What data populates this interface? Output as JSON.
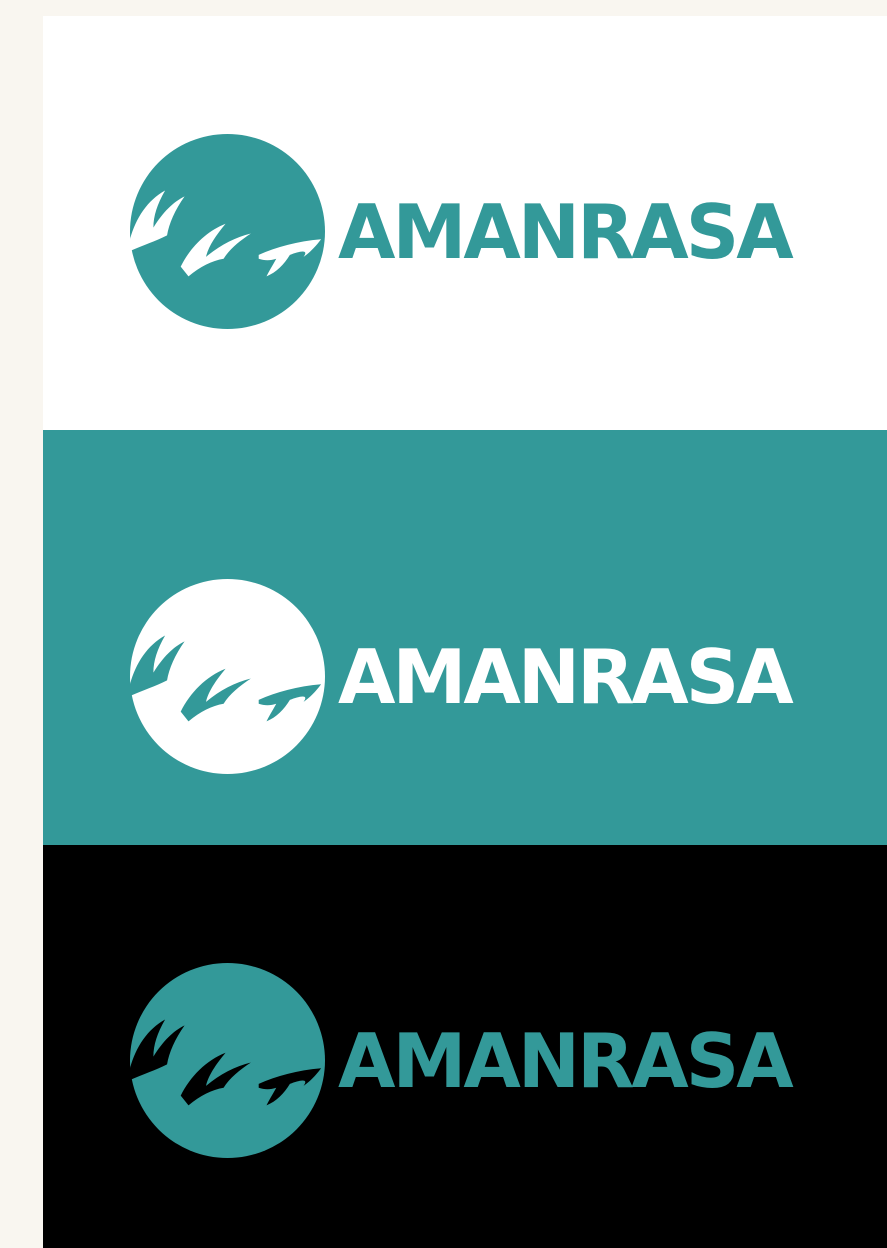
{
  "colors": {
    "page_background": "#F9F6F0",
    "teal": "#339999",
    "white": "#FFFFFF",
    "black": "#000000"
  },
  "logo": {
    "wordmark": "AMANRASA",
    "icon": "circle-with-branch-icon"
  },
  "variants": [
    {
      "label": "teal-on-white",
      "background": "#FFFFFF",
      "circle": "#339999",
      "branch": "#FFFFFF",
      "text": "#339999"
    },
    {
      "label": "white-on-teal",
      "background": "#339999",
      "circle": "#FFFFFF",
      "branch": "#339999",
      "text": "#FFFFFF"
    },
    {
      "label": "teal-on-black",
      "background": "#000000",
      "circle": "#339999",
      "branch": "#000000",
      "text": "#339999"
    }
  ]
}
